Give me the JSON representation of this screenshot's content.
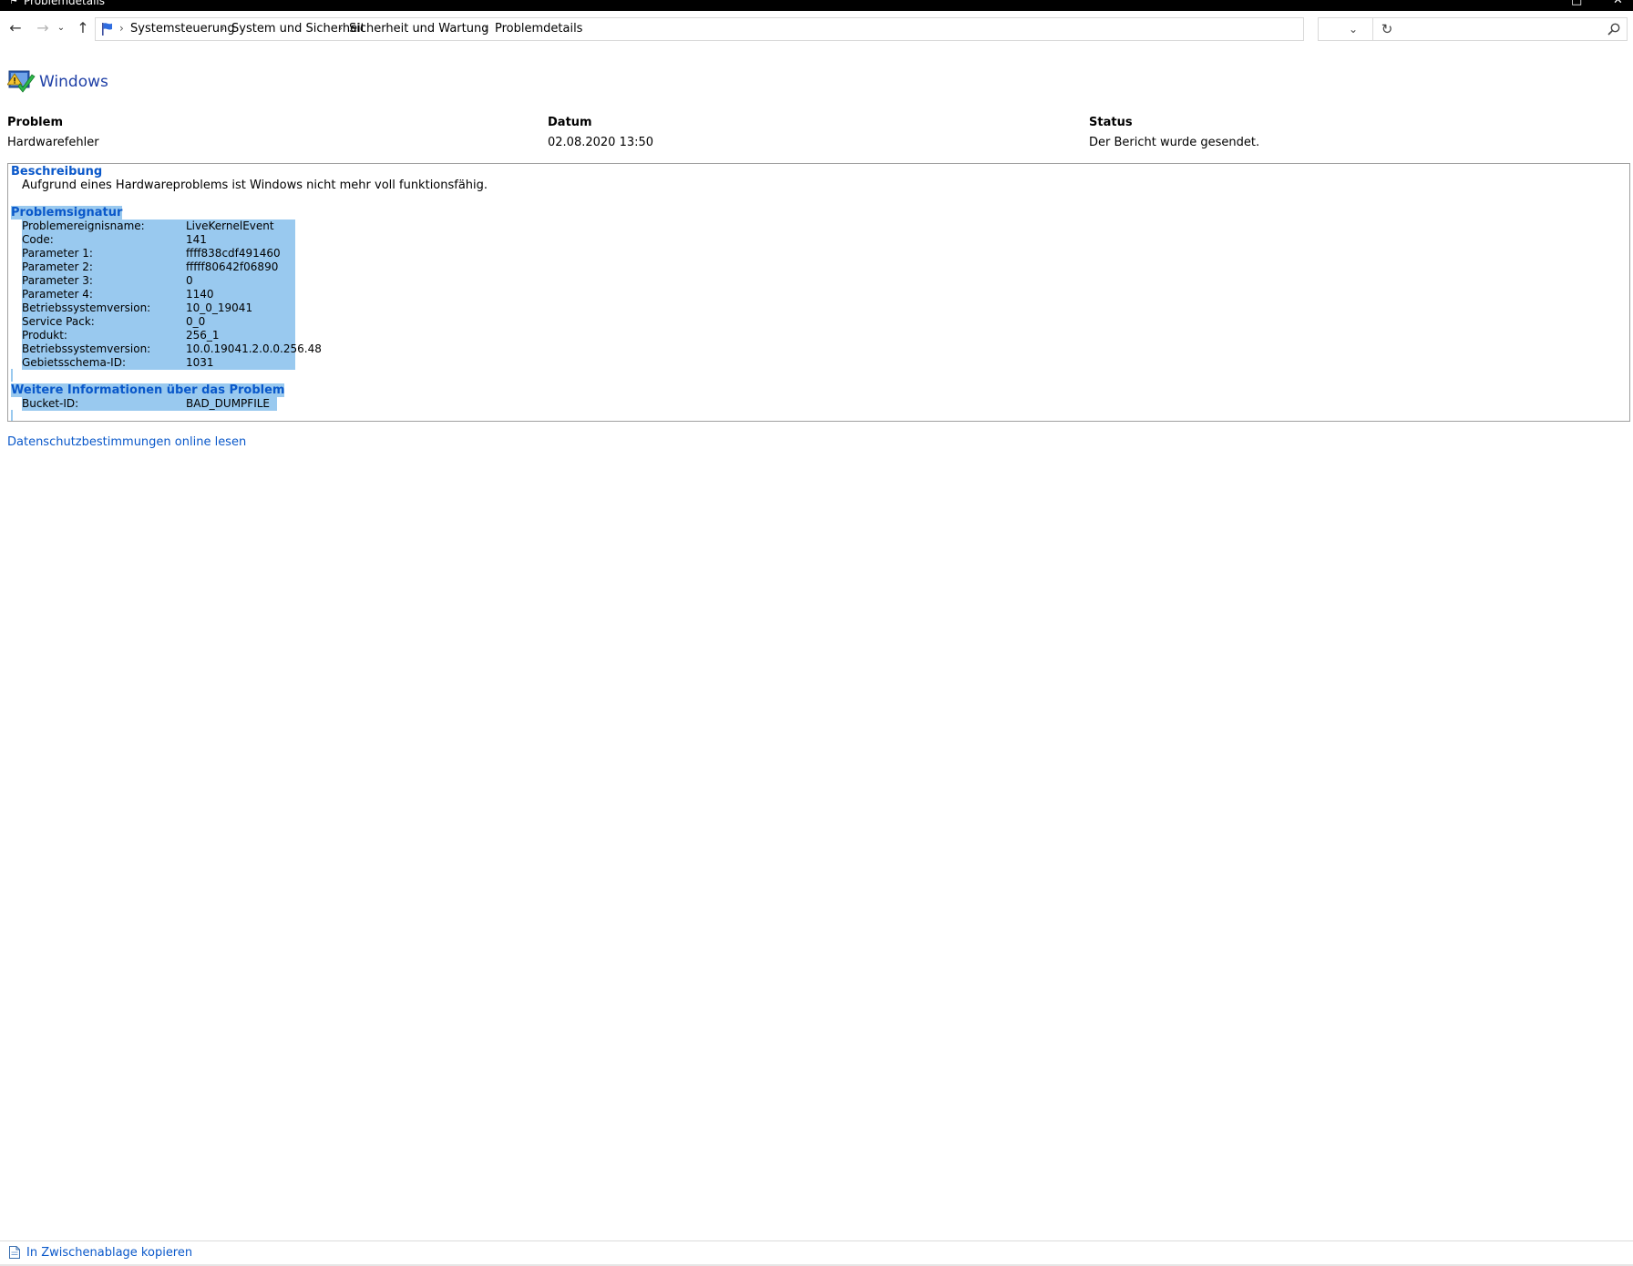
{
  "window": {
    "title": "Problemdetails",
    "maximize_glyph": "□",
    "close_glyph": "✕"
  },
  "nav": {
    "back_glyph": "←",
    "forward_glyph": "→",
    "recent_glyph": "⌄",
    "up_glyph": "↑",
    "dropdown_glyph": "⌄",
    "refresh_glyph": "↻",
    "separator": "›",
    "breadcrumbs": [
      {
        "label": "Systemsteuerung"
      },
      {
        "label": "System und Sicherheit"
      },
      {
        "label": "Sicherheit und Wartung"
      },
      {
        "label": "Problemdetails"
      }
    ],
    "search_value": ""
  },
  "header": {
    "app_name": "Windows",
    "columns": [
      {
        "label": "Problem",
        "value": "Hardwarefehler"
      },
      {
        "label": "Datum",
        "value": "02.08.2020 13:50"
      },
      {
        "label": "Status",
        "value": "Der Bericht wurde gesendet."
      }
    ]
  },
  "details": {
    "description_title": "Beschreibung",
    "description_text": "Aufgrund eines Hardwareproblems ist Windows nicht mehr voll funktionsfähig.",
    "signature_title": "Problemsignatur",
    "signature_rows": [
      {
        "key": "Problemereignisname:",
        "value": "LiveKernelEvent"
      },
      {
        "key": "Code:",
        "value": "141"
      },
      {
        "key": "Parameter 1:",
        "value": "ffff838cdf491460"
      },
      {
        "key": "Parameter 2:",
        "value": "fffff80642f06890"
      },
      {
        "key": "Parameter 3:",
        "value": "0"
      },
      {
        "key": "Parameter 4:",
        "value": "1140"
      },
      {
        "key": "Betriebssystemversion:",
        "value": "10_0_19041"
      },
      {
        "key": "Service Pack:",
        "value": "0_0"
      },
      {
        "key": "Produkt:",
        "value": "256_1"
      },
      {
        "key": "Betriebssystemversion:",
        "value": "10.0.19041.2.0.0.256.48"
      },
      {
        "key": "Gebietsschema-ID:",
        "value": "1031"
      }
    ],
    "more_title": "Weitere Informationen über das Problem",
    "more_rows": [
      {
        "key": "Bucket-ID:",
        "value": "BAD_DUMPFILE"
      }
    ]
  },
  "links": {
    "privacy": "Datenschutzbestimmungen online lesen",
    "copy": "In Zwischenablage kopieren"
  },
  "colors": {
    "accent": "#0a58ca",
    "title_blue": "#1e3fa6",
    "selection": "#99c9ef"
  }
}
